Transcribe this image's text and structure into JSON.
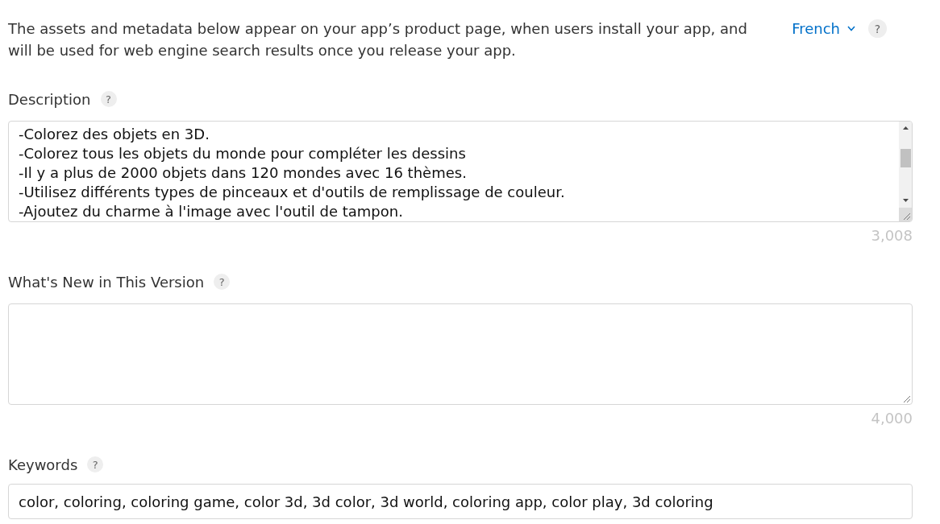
{
  "header": {
    "intro": "The assets and metadata below appear on your app’s product page, when users install your app, and will be used for web engine search results once you release your app.",
    "language": "French",
    "help": "?"
  },
  "fields": [
    {
      "kind": "textarea",
      "label": "Description",
      "help": "?",
      "value": "-Colorez des objets en 3D.\n-Colorez tous les objets du monde pour compléter les dessins\n-Il y a plus de 2000 objets dans 120 mondes avec 16 thèmes.\n-Utilisez différents types de pinceaux et d'outils de remplissage de couleur.\n-Ajoutez du charme à l'image avec l'outil de tampon.",
      "counter": "3,008"
    },
    {
      "kind": "textarea",
      "label": "What's New in This Version",
      "help": "?",
      "counter": "4,000"
    },
    {
      "kind": "input",
      "label": "Keywords",
      "help": "?",
      "value": "color, coloring, coloring game, color 3d, 3d color, 3d world, coloring app, color play, 3d coloring"
    }
  ]
}
